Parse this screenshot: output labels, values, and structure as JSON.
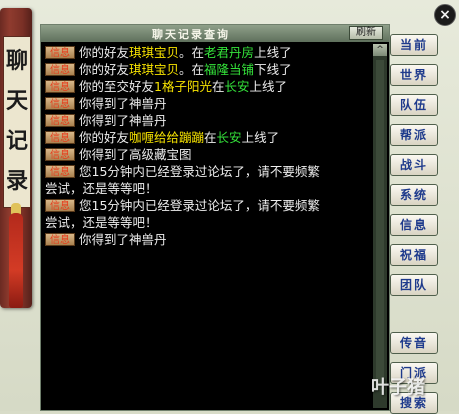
{
  "scroll_banner": {
    "title_chars": [
      "聊",
      "天",
      "记",
      "录"
    ]
  },
  "window": {
    "title": "聊天记录查询",
    "refresh_label": "刷新"
  },
  "scrollbar": {
    "up_arrow": "^"
  },
  "tag_label": "信息",
  "messages": [
    {
      "segments": [
        {
          "text": "你的好友",
          "color": "white"
        },
        {
          "text": "琪琪宝贝",
          "color": "yellow"
        },
        {
          "text": "。在",
          "color": "white"
        },
        {
          "text": "老君丹房",
          "color": "green"
        },
        {
          "text": "上线了",
          "color": "white"
        }
      ]
    },
    {
      "segments": [
        {
          "text": "你的好友",
          "color": "white"
        },
        {
          "text": "琪琪宝贝",
          "color": "yellow"
        },
        {
          "text": "。在",
          "color": "white"
        },
        {
          "text": "福隆当铺",
          "color": "green"
        },
        {
          "text": "下线了",
          "color": "white"
        }
      ]
    },
    {
      "segments": [
        {
          "text": "你的至交好友",
          "color": "white"
        },
        {
          "text": "1格子阳光",
          "color": "yellow"
        },
        {
          "text": "在",
          "color": "white"
        },
        {
          "text": "长安",
          "color": "green"
        },
        {
          "text": "上线了",
          "color": "white"
        }
      ]
    },
    {
      "segments": [
        {
          "text": "你得到了神兽丹",
          "color": "white"
        }
      ]
    },
    {
      "segments": [
        {
          "text": "你得到了神兽丹",
          "color": "white"
        }
      ]
    },
    {
      "segments": [
        {
          "text": "你的好友",
          "color": "white"
        },
        {
          "text": "咖喱给给蹦蹦",
          "color": "yellow"
        },
        {
          "text": "在",
          "color": "white"
        },
        {
          "text": "长安",
          "color": "green"
        },
        {
          "text": "上线了",
          "color": "white"
        }
      ]
    },
    {
      "segments": [
        {
          "text": "你得到了高级藏宝图",
          "color": "white"
        }
      ]
    },
    {
      "segments": [
        {
          "text": "您15分钟内已经登录过论坛了，请不要频繁",
          "color": "white"
        }
      ],
      "continuation": "尝试，还是等等吧！"
    },
    {
      "segments": [
        {
          "text": "您15分钟内已经登录过论坛了，请不要频繁",
          "color": "white"
        }
      ],
      "continuation": "尝试，还是等等吧！"
    },
    {
      "segments": [
        {
          "text": "你得到了神兽丹",
          "color": "white"
        }
      ]
    }
  ],
  "side_tabs": [
    "当前",
    "世界",
    "队伍",
    "帮派",
    "战斗",
    "系统",
    "信息",
    "祝福",
    "团队",
    "传音",
    "门派",
    "搜索"
  ],
  "close_label": "×",
  "watermark": "叶子猪",
  "colors": {
    "yellow": "#f7e300",
    "green": "#34e23a",
    "white": "#ededed",
    "tag_text": "#e83a1a"
  }
}
